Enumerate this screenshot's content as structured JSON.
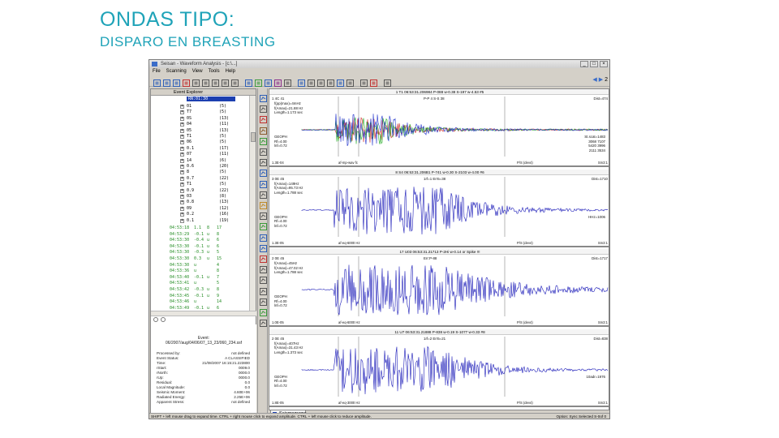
{
  "slide": {
    "title": "ONDAS TIPO:",
    "subtitle": "DISPARO EN BREASTING"
  },
  "app": {
    "window_title": "Seisan - Waveform Analysis - [c:\\...]",
    "menu": [
      "File",
      "Scanning",
      "View",
      "Tools",
      "Help"
    ],
    "toolbar_right_number": "2",
    "left_panel_header": "Event Explorer",
    "tree_selected": "RN:01:30",
    "tree_items": [
      {
        "label": "01",
        "count": "(5)"
      },
      {
        "label": "T7",
        "count": "(5)"
      },
      {
        "label": "0S",
        "count": "(13)"
      },
      {
        "label": "04",
        "count": "(11)"
      },
      {
        "label": "05",
        "count": "(13)"
      },
      {
        "label": "T1",
        "count": "(5)"
      },
      {
        "label": "06",
        "count": "(5)"
      },
      {
        "label": "0.1",
        "count": "(17)"
      },
      {
        "label": "07",
        "count": "(11)"
      },
      {
        "label": "14",
        "count": "(6)"
      },
      {
        "label": "0.6",
        "count": "(20)"
      },
      {
        "label": "8",
        "count": "(5)"
      },
      {
        "label": "0.7",
        "count": "(22)"
      },
      {
        "label": "T1",
        "count": "(5)"
      },
      {
        "label": "0.9",
        "count": "(22)"
      },
      {
        "label": "03",
        "count": "(8)"
      },
      {
        "label": "0.8",
        "count": "(13)"
      },
      {
        "label": "09",
        "count": "(12)"
      },
      {
        "label": "0.2",
        "count": "(16)"
      },
      {
        "label": "0.1",
        "count": "(19)"
      }
    ],
    "event_rows": [
      [
        "04:53:18",
        "1.1",
        "8",
        "17"
      ],
      [
        "04:53:29",
        "-0.1",
        "u",
        "8"
      ],
      [
        "04:53:30",
        "-0.4",
        "u",
        "6"
      ],
      [
        "04:53:30",
        "-0.1",
        "u",
        "6"
      ],
      [
        "04:53:30",
        "-0.3",
        "u",
        "5"
      ],
      [
        "04:53:30",
        "0.3",
        "u",
        "15"
      ],
      [
        "04:53:30",
        "u",
        "",
        "4"
      ],
      [
        "04:53:36",
        "u",
        "",
        "8"
      ],
      [
        "04:53:40",
        "-0.1",
        "u",
        "7"
      ],
      [
        "04:53:41",
        "u",
        "",
        "5"
      ],
      [
        "04:53:42",
        "-0.3",
        "u",
        "8"
      ],
      [
        "04:53:45",
        "-0.1",
        "u",
        "9"
      ],
      [
        "04:53:46",
        "u",
        "",
        "14"
      ],
      [
        "04:53:49",
        "-0.1",
        "u",
        "6"
      ],
      [
        "04:53:49",
        "u",
        "",
        "4"
      ]
    ],
    "event_info": {
      "title": "Event:",
      "filename": "06/2007/aug/04/06/07_13_23/060_234.ssf",
      "fields": [
        {
          "k": "Processed by:",
          "v": "not defined"
        },
        {
          "k": "Event Status:",
          "v": "A CLASSIFIED"
        },
        {
          "k": "Time:",
          "v": "21/08/2007 16:15:21.223800"
        },
        {
          "k": "rStart:",
          "v": "0009.0"
        },
        {
          "k": "rNorth:",
          "v": "0000.0"
        },
        {
          "k": "rUp:",
          "v": "0000.0"
        },
        {
          "k": "Residual:",
          "v": "0.0"
        },
        {
          "k": "Local Magnitude:",
          "v": "0.0"
        },
        {
          "k": "Seismic Moment:",
          "v": "4.60E+06"
        },
        {
          "k": "Radiated Energy:",
          "v": "2.25E+06"
        },
        {
          "k": "Apparent Stress:",
          "v": "not defined"
        }
      ]
    },
    "traces": [
      {
        "header": "1 T1 06:53:31.206984 P-088 w-0.38 S-197 w-4.53 #5",
        "left_top": "1 4C 41",
        "center_top": "P-P 4 S-S 38",
        "right_top": "Dist=474",
        "labels": [
          "f(pp(max)=4mHz",
          "f(Amax)=21.88 Hz",
          "Length=1.173 sec"
        ],
        "sensor": [
          "GEOPH",
          "Rf=4.00",
          "lnf=0.72"
        ],
        "right_mid": [
          "St.scat=1483",
          "3068 7107",
          "5420 3996",
          "2111 3534"
        ],
        "foot_left": "1.3E-04",
        "foot_mid": "af-mp-wav fc",
        "foot_right": "P/S (dev4)",
        "foot_far": "Sm3:1",
        "color": "multi"
      },
      {
        "header": "8 S4 06:53:31.206B1 P-741 w-0.30 S-2103 w-4.00 #6",
        "left_top": "3 0E 45",
        "center_top": "1rf=1 Err5=38",
        "right_top": "Dist=1710",
        "labels": [
          "f(Amax)=149Hz",
          "f(Amax)=95.73 Hz",
          "Length=1.788 sec"
        ],
        "sensor": [
          "GEOPH",
          "Rf=4.00",
          "lnf=0.72"
        ],
        "right_mid": [
          "HHz=1006"
        ],
        "foot_left": "1.3E-05",
        "foot_mid": "af-eq-6000 Hz",
        "foot_right": "P/S (dev4)",
        "foot_far": "Sm3:1",
        "color": "#1a1ab8"
      },
      {
        "header": "17 U03 06:53:31.21713 P-2Hi w-0.14 or Spike !!!",
        "left_top": "2 0E 45",
        "center_top": "Err:P-88",
        "right_top": "Dist=1717",
        "labels": [
          "f(Amax)=45Hz",
          "f(Amax)=47.02 Hz",
          "Length=1.788 sec"
        ],
        "sensor": [
          "GEOPH",
          "Rf=4.00",
          "lnf=0.72"
        ],
        "right_mid": [],
        "foot_left": "1.0E-05",
        "foot_mid": "af-eq-6000 Hz",
        "foot_right": "P/S (dev4)",
        "foot_far": "Sm3:1",
        "color": "#1a1ab8"
      },
      {
        "header": "11 U7 06:53:31.21888 P-838 w-0.19 S-1077 w-0.33 #8",
        "left_top": "2 0E 45",
        "center_top": "1rf=2 Err5=21",
        "right_top": "Dist=838",
        "labels": [
          "f(Amax)=407Hz",
          "f(Amax)=31.43 Hz",
          "Length=1.373 sec"
        ],
        "sensor": [
          "GEOPH",
          "Rf=4.00",
          "lnf=0.72"
        ],
        "right_mid": [
          "10adr=1976"
        ],
        "foot_left": "1.8E-05",
        "foot_mid": "af-eq-3000 Hz",
        "foot_right": "P/S (dev4)",
        "foot_far": "Sm3:1",
        "color": "#1a1ab8"
      }
    ],
    "tab_label": "Seismograms",
    "status_left": "SHIFT + left mouse drag to expand time.  CTRL + right mouse click to expand amplitude.  CTRL + left mouse click to reduce amplitude.",
    "status_right": "Option:  Sync Selected  S-0of 0"
  }
}
